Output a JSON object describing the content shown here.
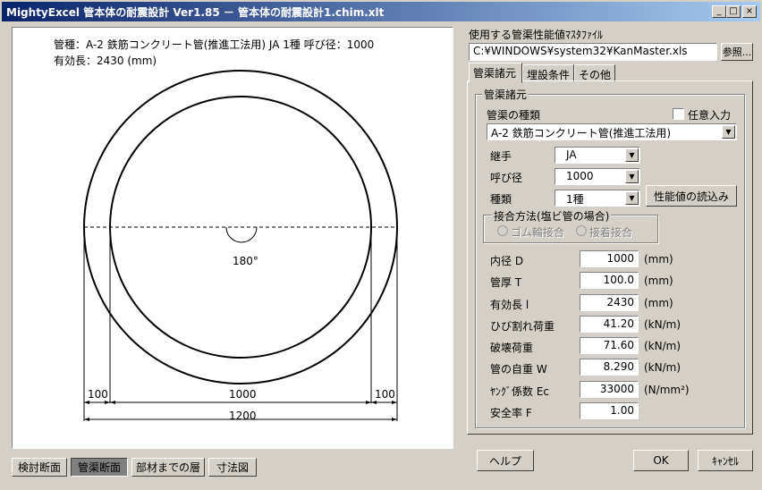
{
  "window": {
    "title": "MightyExcel 管本体の耐震設計 Ver1.85  －  管本体の耐震設計1.chim.xlt",
    "minimize": "_",
    "maximize": "□",
    "close": "×"
  },
  "drawing": {
    "caption_line1": "管種：A-2  鉄筋コンクリート管(推進工法用) JA 1種   呼び径：1000",
    "caption_line2": "有効長：2430 (mm)",
    "angle_label": "180°",
    "dim_left": "100",
    "dim_center": "1000",
    "dim_right": "100",
    "dim_total": "1200"
  },
  "bottom_tabs": [
    {
      "label": "検討断面",
      "active": false
    },
    {
      "label": "管渠断面",
      "active": true
    },
    {
      "label": "部材までの層",
      "active": false
    },
    {
      "label": "寸法図",
      "active": false
    }
  ],
  "master_file": {
    "label": "使用する管渠性能値ﾏｽﾀﾌｧｲﾙ",
    "path": "C:¥WINDOWS¥system32¥KanMaster.xls",
    "browse_label": "参照..."
  },
  "tabs": [
    {
      "label": "管渠諸元",
      "active": true
    },
    {
      "label": "埋設条件",
      "active": false
    },
    {
      "label": "その他",
      "active": false
    }
  ],
  "spec": {
    "group_title": "管渠諸元",
    "type_label": "管渠の種類",
    "manual_input_label": "任意入力",
    "manual_input_checked": false,
    "type_value": "A-2  鉄筋コンクリート管(推進工法用)",
    "joint_label": "継手",
    "joint_value": "JA",
    "diameter_label": "呼び径",
    "diameter_value": "1000",
    "kind_label": "種類",
    "kind_value": "1種",
    "load_button": "性能値の読込み",
    "connect_group_title": "接合方法(塩ビ管の場合)",
    "radio_rubber": "ゴム輪接合",
    "radio_adhesive": "接着接合"
  },
  "properties": [
    {
      "label": "内径 D",
      "value": "1000",
      "unit": "(mm)"
    },
    {
      "label": "管厚 T",
      "value": "100.0",
      "unit": "(mm)"
    },
    {
      "label": "有効長 l",
      "value": "2430",
      "unit": "(mm)"
    },
    {
      "label": "ひび割れ荷重",
      "value": "41.20",
      "unit": "(kN/m)"
    },
    {
      "label": "破壊荷重",
      "value": "71.60",
      "unit": "(kN/m)"
    },
    {
      "label": "管の自重 W",
      "value": "8.290",
      "unit": "(kN/m)"
    },
    {
      "label": "ﾔﾝｸﾞ係数 Ec",
      "value": "33000",
      "unit": "(N/mm²)"
    },
    {
      "label": "安全率 F",
      "value": "1.00",
      "unit": ""
    }
  ],
  "buttons": {
    "help": "ヘルプ",
    "ok": "OK",
    "cancel": "ｷｬﾝｾﾙ"
  }
}
